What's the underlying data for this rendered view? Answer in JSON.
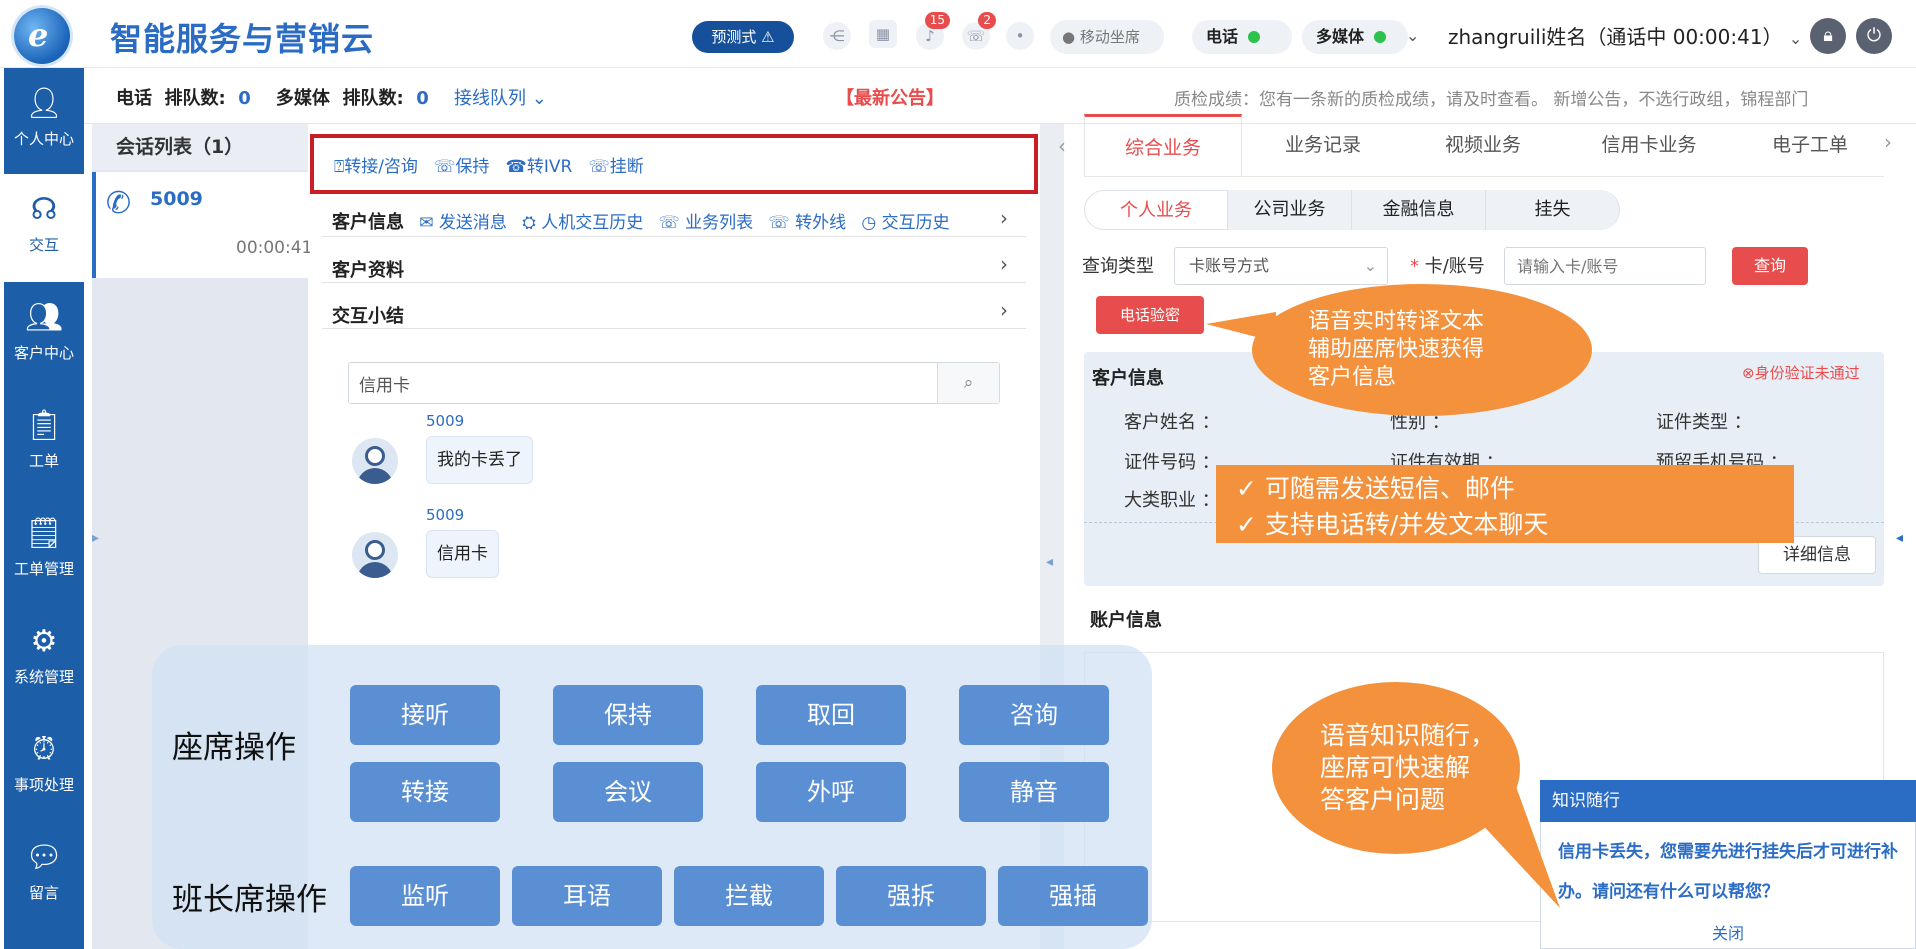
{
  "app": {
    "title": "智能服务与营销云",
    "logo_glyph": "e"
  },
  "topbar": {
    "pretest_label": "预测式",
    "notify_badge": "15",
    "phone_badge": "2",
    "mobile_seat_label": "移动坐席",
    "phone_label": "电话",
    "multimedia_label": "多媒体",
    "user_status": "zhangruili姓名（通话中 00:00:41）"
  },
  "sidebar": {
    "items": [
      {
        "label": "个人中心",
        "icon": "user-icon"
      },
      {
        "label": "交互",
        "icon": "headset-icon"
      },
      {
        "label": "客户中心",
        "icon": "customers-icon"
      },
      {
        "label": "工单",
        "icon": "clipboard-icon"
      },
      {
        "label": "工单管理",
        "icon": "clipboard-gear-icon"
      },
      {
        "label": "系统管理",
        "icon": "gear-icon"
      },
      {
        "label": "事项处理",
        "icon": "alarm-icon"
      },
      {
        "label": "留言",
        "icon": "message-icon"
      }
    ]
  },
  "subbar": {
    "phone_label": "电话",
    "queue_label": "排队数:",
    "phone_queue": "0",
    "multimedia_label": "多媒体",
    "mm_queue_label": "排队数:",
    "mm_queue": "0",
    "line_queue": "接线队列",
    "announcement": "【最新公告】",
    "notice": "质检成绩：您有一条新的质检成绩，请及时查看。 新增公告，不选行政组，锦程部门"
  },
  "sessions": {
    "header": "会话列表（1）",
    "items": [
      {
        "number": "5009",
        "time": "00:00:41"
      }
    ]
  },
  "call_actions": [
    "转接/咨询",
    "保持",
    "转IVR",
    "挂断"
  ],
  "customer_toolbar": {
    "title": "客户信息",
    "links": [
      "发送消息",
      "人机交互历史",
      "业务列表",
      "转外线",
      "交互历史"
    ]
  },
  "sections": {
    "profile": "客户资料",
    "summary": "交互小结"
  },
  "chat": {
    "search_value": "信用卡",
    "messages": [
      {
        "sender": "5009",
        "text": "我的卡丢了"
      },
      {
        "sender": "5009",
        "text": "信用卡"
      }
    ]
  },
  "right": {
    "tabs": [
      "综合业务",
      "业务记录",
      "视频业务",
      "信用卡业务",
      "电子工单"
    ],
    "subtabs": [
      "个人业务",
      "公司业务",
      "金融信息",
      "挂失"
    ],
    "query_type_label": "查询类型",
    "query_type_value": "卡账号方式",
    "card_label": "卡/账号",
    "card_placeholder": "请输入卡/账号",
    "query_button": "查询",
    "phone_verify": "电话验密",
    "customer_info_title": "客户信息",
    "id_verify_status": "身份验证未通过",
    "fields": {
      "name": "客户姓名 ：",
      "gender": "性别 ：",
      "id_type": "证件类型 ：",
      "id_number": "证件号码 ：",
      "id_valid": "证件有效期 ：",
      "phone": "预留手机号码 ：",
      "occupation": "大类职业 ："
    },
    "detail_button": "详细信息",
    "account_info_title": "账户信息"
  },
  "callouts": {
    "speech_line1": "语音实时转译文本",
    "speech_line2": "辅助座席快速获得",
    "speech_line3": "客户信息",
    "feature1": "✓  可随需发送短信、邮件",
    "feature2": "✓  支持电话转/并发文本聊天",
    "kb_line1": "语音知识随行，",
    "kb_line2": "座席可快速解",
    "kb_line3": "答客户问题"
  },
  "operations": {
    "seat_label": "座席操作",
    "seat_buttons": [
      "接听",
      "保持",
      "取回",
      "咨询",
      "转接",
      "会议",
      "外呼",
      "静音"
    ],
    "leader_label": "班长席操作",
    "leader_buttons": [
      "监听",
      "耳语",
      "拦截",
      "强拆",
      "强插"
    ]
  },
  "knowledge": {
    "title": "知识随行",
    "text": "信用卡丢失，您需要先进行挂失后才可进行补办。请问还有什么可以帮您？",
    "close": "关闭"
  },
  "colors": {
    "brand": "#1d5ea8",
    "accent_red": "#e84d4d",
    "callout_orange": "#f3913d",
    "active_tab": "#e84d4d"
  }
}
